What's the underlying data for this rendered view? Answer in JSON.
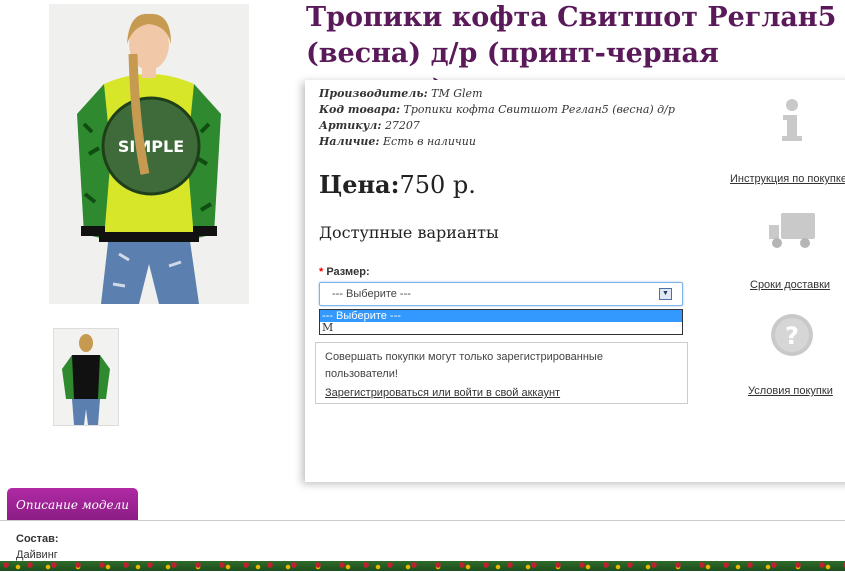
{
  "product": {
    "title": "Тропики кофта Свитшот Реглан5 (весна) д/р (принт-черная отделка)",
    "specs": [
      {
        "label": "Производитель:",
        "value": "ТМ Glem"
      },
      {
        "label": "Код товара:",
        "value": "Тропики кофта Свитшот Реглан5 (весна) д/р"
      },
      {
        "label": "Артикул:",
        "value": "27207"
      },
      {
        "label": "Наличие:",
        "value": "Есть в наличии"
      }
    ],
    "price_label": "Цена:",
    "price_value": "750 р.",
    "variants_heading": "Доступные варианты",
    "size_label": "Размер:",
    "size_selected": "--- Выберите ---",
    "size_options": [
      "--- Выберите ---",
      "M"
    ],
    "image_text": "SIMPLE"
  },
  "notice": {
    "text": "Совершать покупки могут только зарегистрированные пользователи!",
    "link": "Зарегистрироваться или войти в свой аккаунт"
  },
  "sidebar": {
    "items": [
      {
        "icon": "info-icon",
        "label": "Инструкция по покупке"
      },
      {
        "icon": "truck-icon",
        "label": "Сроки доставки"
      },
      {
        "icon": "question-icon",
        "label": "Условия покупки"
      }
    ]
  },
  "tabs": {
    "description": "Описание модели"
  },
  "description": {
    "composition_label": "Состав:",
    "composition_value": "Дайвинг"
  },
  "colors": {
    "title": "#5a1a5a",
    "tab": "#9b239a",
    "select_highlight": "#3399ff"
  }
}
